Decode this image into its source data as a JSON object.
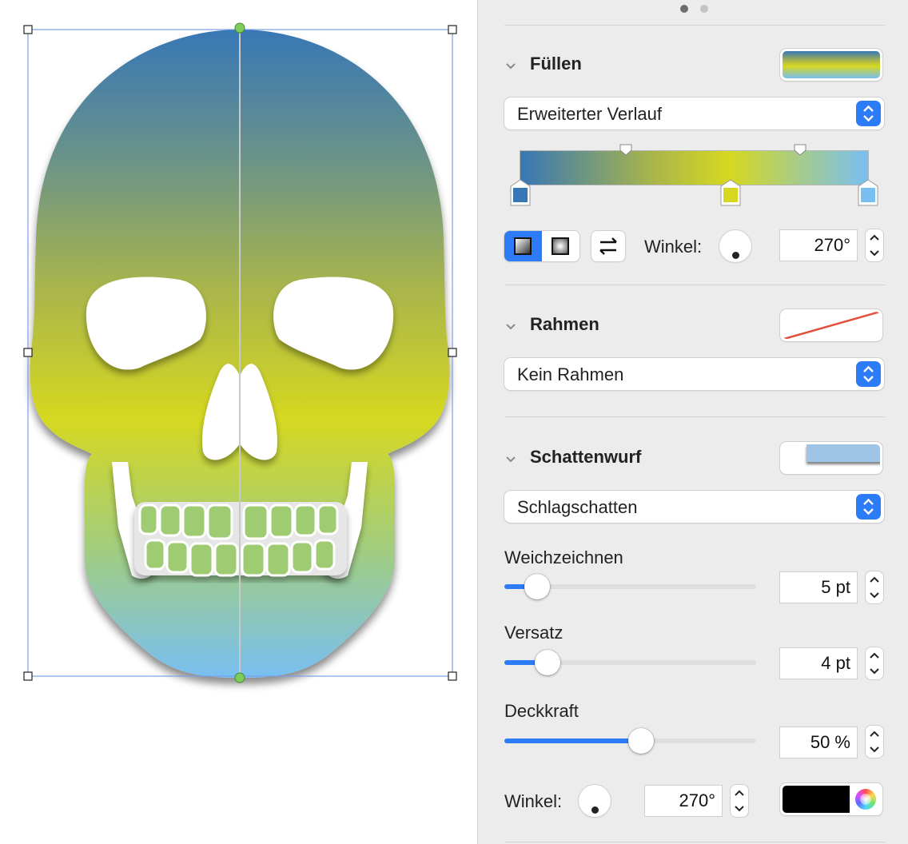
{
  "fill": {
    "title": "Füllen",
    "type": "Erweiterter Verlauf",
    "gradient_stops": [
      "#3777b5",
      "#d6d820",
      "#78bff2"
    ],
    "angle_label": "Winkel:",
    "angle_value": "270°"
  },
  "border": {
    "title": "Rahmen",
    "type": "Kein Rahmen"
  },
  "shadow": {
    "title": "Schattenwurf",
    "type": "Schlagschatten",
    "blur": {
      "label": "Weichzeichnen",
      "value": "5 pt",
      "level": 0.09
    },
    "offset": {
      "label": "Versatz",
      "value": "4 pt",
      "level": 0.13
    },
    "opacity": {
      "label": "Deckkraft",
      "value": "50 %",
      "level": 0.5
    },
    "angle_label": "Winkel:",
    "angle_value": "270°",
    "color": "#000000"
  },
  "page_dots": {
    "count": 2,
    "active": 0
  },
  "colors": {
    "accent": "#2b7cf6",
    "shadow_swatch": "#9ec5e6",
    "border_line": "#e0503c"
  }
}
